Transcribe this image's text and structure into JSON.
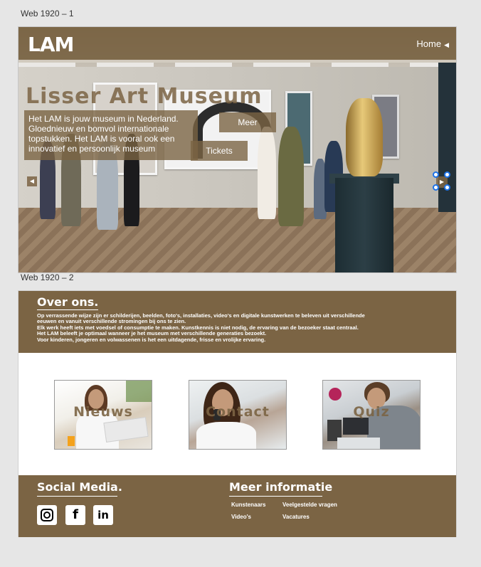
{
  "frames": {
    "frame1_label": "Web 1920 – 1",
    "frame2_label": "Web 1920 – 2"
  },
  "header": {
    "logo": "LAM",
    "home": "Home",
    "home_arrow": "◀"
  },
  "hero": {
    "title": "Lisser Art Museum",
    "text": "Het LAM is jouw museum in Nederland. Gloednieuw en bomvol internationale topstukken. Het LAM is vooral ook een innovatief en persoonlijk museum",
    "meer_button": "Meer",
    "tickets_button": "Tickets",
    "prev_arrow": "◀",
    "next_arrow": "▶"
  },
  "about": {
    "title": "Over ons.",
    "lines": [
      "Op verrassende wijze zijn er schilderijen, beelden, foto's, installaties, video's en digitale kunstwerken te beleven uit verschillende",
      "eeuwen en vanuit verschillende stromingen bij ons te zien.",
      "Elk werk heeft iets met voedsel of consumptie te maken. Kunstkennis is niet nodig, de ervaring van de bezoeker staat centraal.",
      "Het LAM beleeft je optimaal wanneer je het museum met verschillende generaties bezoekt.",
      "Voor kinderen, jongeren en volwassenen is het een uitdagende, frisse en vrolijke ervaring."
    ]
  },
  "cards": [
    {
      "label": "Nieuws"
    },
    {
      "label": "Contact"
    },
    {
      "label": "Quiz"
    }
  ],
  "footer": {
    "social_title": "Social Media.",
    "info_title": "Meer informatie",
    "social_icons": [
      "instagram-icon",
      "facebook-icon",
      "linkedin-icon"
    ],
    "facebook_glyph": "f",
    "linkedin_glyph": "in",
    "links": [
      "Kunstenaars",
      "Veelgestelde vragen",
      "Video's",
      "Vacatures"
    ]
  },
  "colors": {
    "brand_brown": "#7b6444",
    "selection_blue": "#1e73e8"
  }
}
